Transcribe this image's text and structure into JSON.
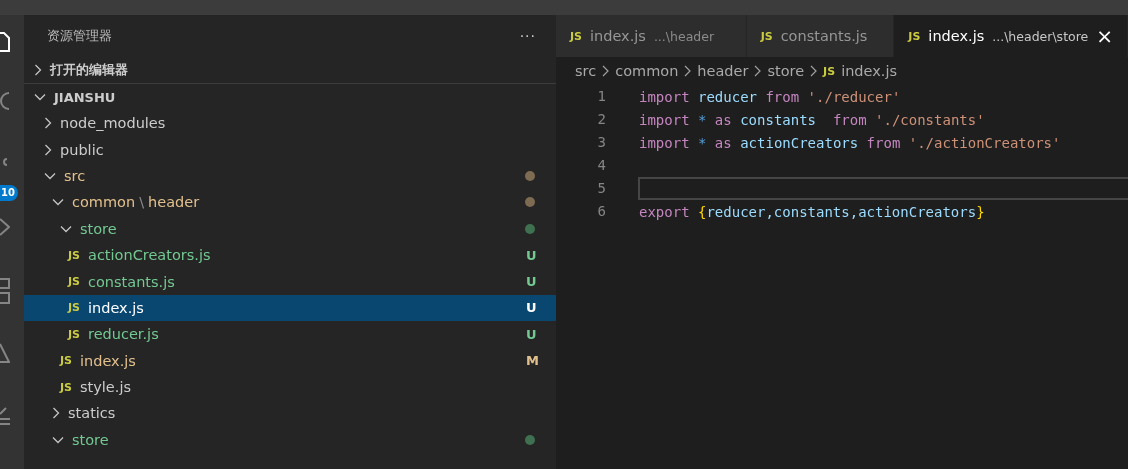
{
  "activity_bar": {
    "source_control_badge": "10"
  },
  "sidebar": {
    "title": "资源管理器",
    "more": "···",
    "sections": [
      {
        "label": "打开的编辑器",
        "expanded": false
      },
      {
        "label": "JIANSHU",
        "expanded": true
      }
    ],
    "tree": [
      {
        "kind": "folder",
        "name": "node_modules",
        "expanded": false,
        "color": "#cccccc",
        "selected": false
      },
      {
        "kind": "folder",
        "name": "public",
        "expanded": false,
        "color": "#cccccc",
        "selected": false
      },
      {
        "kind": "folder",
        "name": "src",
        "expanded": true,
        "color": "#e2c08d",
        "selected": false,
        "dot": {
          "color": "#7d6b52"
        },
        "children": [
          {
            "kind": "folder",
            "path": [
              "common",
              "header"
            ],
            "separator": "\\",
            "expanded": true,
            "color": "#e2c08d",
            "selected": false,
            "dot": {
              "color": "#7d6b52"
            },
            "children": [
              {
                "kind": "folder",
                "name": "store",
                "expanded": true,
                "color": "#73c991",
                "selected": false,
                "dot": {
                  "color": "#3f7150"
                },
                "children": [
                  {
                    "kind": "file",
                    "icon": "JS",
                    "name": "actionCreators.js",
                    "color": "#73c991",
                    "selected": false,
                    "badge": "U"
                  },
                  {
                    "kind": "file",
                    "icon": "JS",
                    "name": "constants.js",
                    "color": "#73c991",
                    "selected": false,
                    "badge": "U"
                  },
                  {
                    "kind": "file",
                    "icon": "JS",
                    "name": "index.js",
                    "color": "#ffffff",
                    "selected": true,
                    "badge": "U"
                  },
                  {
                    "kind": "file",
                    "icon": "JS",
                    "name": "reducer.js",
                    "color": "#73c991",
                    "selected": false,
                    "badge": "U"
                  }
                ]
              },
              {
                "kind": "file",
                "icon": "JS",
                "name": "index.js",
                "color": "#e2c08d",
                "selected": false,
                "badge": "M"
              },
              {
                "kind": "file",
                "icon": "JS",
                "name": "style.js",
                "color": "#cccccc",
                "selected": false
              }
            ]
          },
          {
            "kind": "folder",
            "name": "statics",
            "expanded": false,
            "color": "#cccccc",
            "selected": false
          },
          {
            "kind": "folder",
            "name": "store",
            "expanded": true,
            "color": "#73c991",
            "selected": false,
            "dot": {
              "color": "#3f7150"
            }
          }
        ]
      }
    ]
  },
  "tabs": [
    {
      "icon": "JS",
      "label": "index.js",
      "description": "...\\header",
      "selected": false
    },
    {
      "icon": "JS",
      "label": "constants.js",
      "selected": false
    },
    {
      "icon": "JS",
      "label": "index.js",
      "description": "...\\header\\store",
      "selected": true,
      "close": "×"
    }
  ],
  "breadcrumbs": {
    "items": [
      "src",
      "common",
      "header",
      "store"
    ],
    "file_icon": "JS",
    "file": "index.js"
  },
  "code": [
    {
      "number": "1",
      "current": false,
      "tokens": [
        {
          "kind": "keyword",
          "text": "import"
        },
        {
          "kind": "variable",
          "text": " reducer"
        },
        {
          "kind": "keyword",
          "text": " from"
        },
        {
          "kind": "string",
          "text": " './reducer'"
        }
      ]
    },
    {
      "number": "2",
      "current": false,
      "tokens": [
        {
          "kind": "keyword",
          "text": "import"
        },
        {
          "kind": "operator",
          "text": " *"
        },
        {
          "kind": "keyword",
          "text": " as"
        },
        {
          "kind": "variable",
          "text": " constants"
        },
        {
          "kind": "keyword",
          "text": "  from"
        },
        {
          "kind": "string",
          "text": " './constants'"
        }
      ]
    },
    {
      "number": "3",
      "current": false,
      "tokens": [
        {
          "kind": "keyword",
          "text": "import"
        },
        {
          "kind": "operator",
          "text": " *"
        },
        {
          "kind": "keyword",
          "text": " as"
        },
        {
          "kind": "variable",
          "text": " actionCreators"
        },
        {
          "kind": "keyword",
          "text": " from"
        },
        {
          "kind": "string",
          "text": " './actionCreators'"
        }
      ]
    },
    {
      "number": "4",
      "current": false
    },
    {
      "number": "5",
      "current": true
    },
    {
      "number": "6",
      "current": false,
      "tokens": [
        {
          "kind": "keyword",
          "text": "export"
        },
        {
          "kind": "bracket",
          "text": " {"
        },
        {
          "kind": "variable",
          "text": "reducer,constants,actionCreators"
        },
        {
          "kind": "bracket",
          "text": "}"
        }
      ]
    }
  ]
}
